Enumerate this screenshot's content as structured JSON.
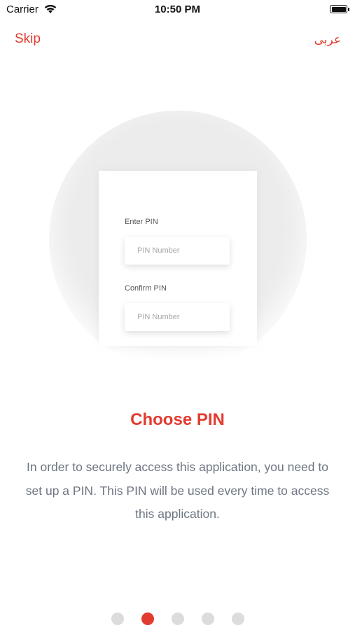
{
  "status_bar": {
    "carrier": "Carrier",
    "time": "10:50 PM",
    "icons": [
      "wifi-icon",
      "battery-icon"
    ]
  },
  "nav": {
    "skip_label": "Skip",
    "language_label": "عربى"
  },
  "illustration": {
    "enter_pin_label": "Enter PIN",
    "enter_pin_placeholder": "PIN Number",
    "confirm_pin_label": "Confirm PIN",
    "confirm_pin_placeholder": "PIN Number"
  },
  "onboarding": {
    "title": "Choose PIN",
    "description": "In order to securely access this application, you need to set up a PIN. This PIN will be used every time to access this application.",
    "page_count": 5,
    "active_page": 2
  },
  "colors": {
    "accent": "#e23b2f",
    "body_text": "#6d7682",
    "dot_inactive": "#dcdcdc"
  }
}
